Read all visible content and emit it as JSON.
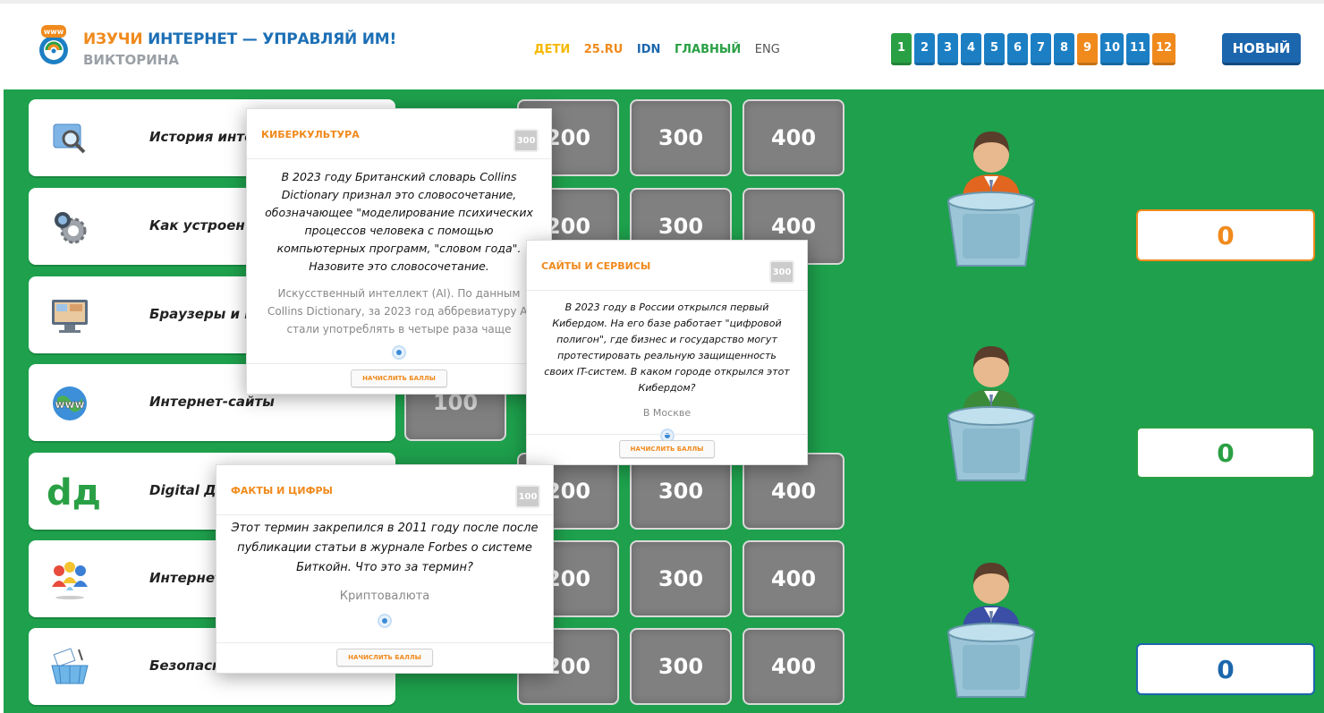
{
  "header": {
    "title_part1": "ИЗУЧИ ",
    "title_part2": "ИНТЕРНЕТ — УПРАВЛЯЙ ИМ!",
    "subtitle": "ВИКТОРИНА",
    "links": [
      {
        "label": "ДЕТИ",
        "color": "#f5b800"
      },
      {
        "label": "25.RU",
        "color": "#f08a1d"
      },
      {
        "label": "IDN",
        "color": "#1c66ad"
      },
      {
        "label": "ГЛАВНЫЙ",
        "color": "#2aa045"
      }
    ],
    "lang": "ENG",
    "rounds": [
      {
        "label": "1",
        "color": "#2aa045"
      },
      {
        "label": "2",
        "color": "#1c7fc4"
      },
      {
        "label": "3",
        "color": "#1c7fc4"
      },
      {
        "label": "4",
        "color": "#1c7fc4"
      },
      {
        "label": "5",
        "color": "#1c7fc4"
      },
      {
        "label": "6",
        "color": "#1c7fc4"
      },
      {
        "label": "7",
        "color": "#1c7fc4"
      },
      {
        "label": "8",
        "color": "#1c7fc4"
      },
      {
        "label": "9",
        "color": "#f08a1d"
      },
      {
        "label": "10",
        "color": "#1c7fc4"
      },
      {
        "label": "11",
        "color": "#1c7fc4"
      },
      {
        "label": "12",
        "color": "#f08a1d"
      }
    ],
    "new_button": "НОВЫЙ"
  },
  "categories": [
    {
      "label": "История интер",
      "icon": "magnifier-icon"
    },
    {
      "label": "Как устроен ин",
      "icon": "gear-globe-icon"
    },
    {
      "label": "Браузеры и инт",
      "icon": "monitor-icon"
    },
    {
      "label": "Интернет-сайты",
      "icon": "www-globe-icon"
    },
    {
      "label": "Digital Ди",
      "icon": "dd-icon",
      "icon_text": "dд"
    },
    {
      "label": "Интернет-",
      "icon": "people-icon"
    },
    {
      "label": "Безопасно",
      "icon": "mail-basket-icon"
    }
  ],
  "tiles": [
    {
      "row": 0,
      "col": 1,
      "label": "200"
    },
    {
      "row": 0,
      "col": 2,
      "label": "300"
    },
    {
      "row": 0,
      "col": 3,
      "label": "400"
    },
    {
      "row": 1,
      "col": 1,
      "label": "200"
    },
    {
      "row": 1,
      "col": 2,
      "label": "300"
    },
    {
      "row": 1,
      "col": 3,
      "label": "400"
    },
    {
      "row": 3,
      "col": 0,
      "label": "100"
    },
    {
      "row": 4,
      "col": 1,
      "label": "200"
    },
    {
      "row": 4,
      "col": 2,
      "label": "300"
    },
    {
      "row": 4,
      "col": 3,
      "label": "400"
    },
    {
      "row": 5,
      "col": 1,
      "label": "200"
    },
    {
      "row": 5,
      "col": 2,
      "label": "300"
    },
    {
      "row": 5,
      "col": 3,
      "label": "400"
    },
    {
      "row": 6,
      "col": 1,
      "label": "200"
    },
    {
      "row": 6,
      "col": 2,
      "label": "300"
    },
    {
      "row": 6,
      "col": 3,
      "label": "400"
    }
  ],
  "players": [
    {
      "score": "0",
      "color": "#f08a1d",
      "shirt": "#e2661f"
    },
    {
      "score": "0",
      "color": "#2aa045",
      "shirt": "#3a8a3a"
    },
    {
      "score": "0",
      "color": "#1c66ad",
      "shirt": "#3a4fa5"
    }
  ],
  "popups": [
    {
      "title": "КИБЕРКУЛЬТУРА",
      "badge": "300",
      "question": "В 2023 году Британский словарь Collins Dictionary признал это словосочетание, обозначающее \"моделирование психических процессов человека с помощью компьютерных программ, \"словом года\". Назовите это словосочетание.",
      "answer": "Искусственный интеллект (AI). По данным Collins Dictionary, за 2023 год аббревиатуру AI стали употреблять в четыре раза чаще",
      "button": "НАЧИСЛИТЬ БАЛЛЫ"
    },
    {
      "title": "САЙТЫ И СЕРВИСЫ",
      "badge": "300",
      "question": "В 2023 году в России открылся первый Кибердом. На его базе работает \"цифровой полигон\", где бизнес и государство могут протестировать реальную защищенность своих IT-систем. В каком городе открылся этот Кибердом?",
      "answer": "В Москве",
      "button": "НАЧИСЛИТЬ БАЛЛЫ"
    },
    {
      "title": "ФАКТЫ И ЦИФРЫ",
      "badge": "100",
      "question": "Этот термин закрепился в 2011 году после после публикации статьи в журнале Forbes о системе Биткойн. Что это за термин?",
      "answer": "Криптовалюта",
      "button": "НАЧИСЛИТЬ БАЛЛЫ"
    }
  ]
}
